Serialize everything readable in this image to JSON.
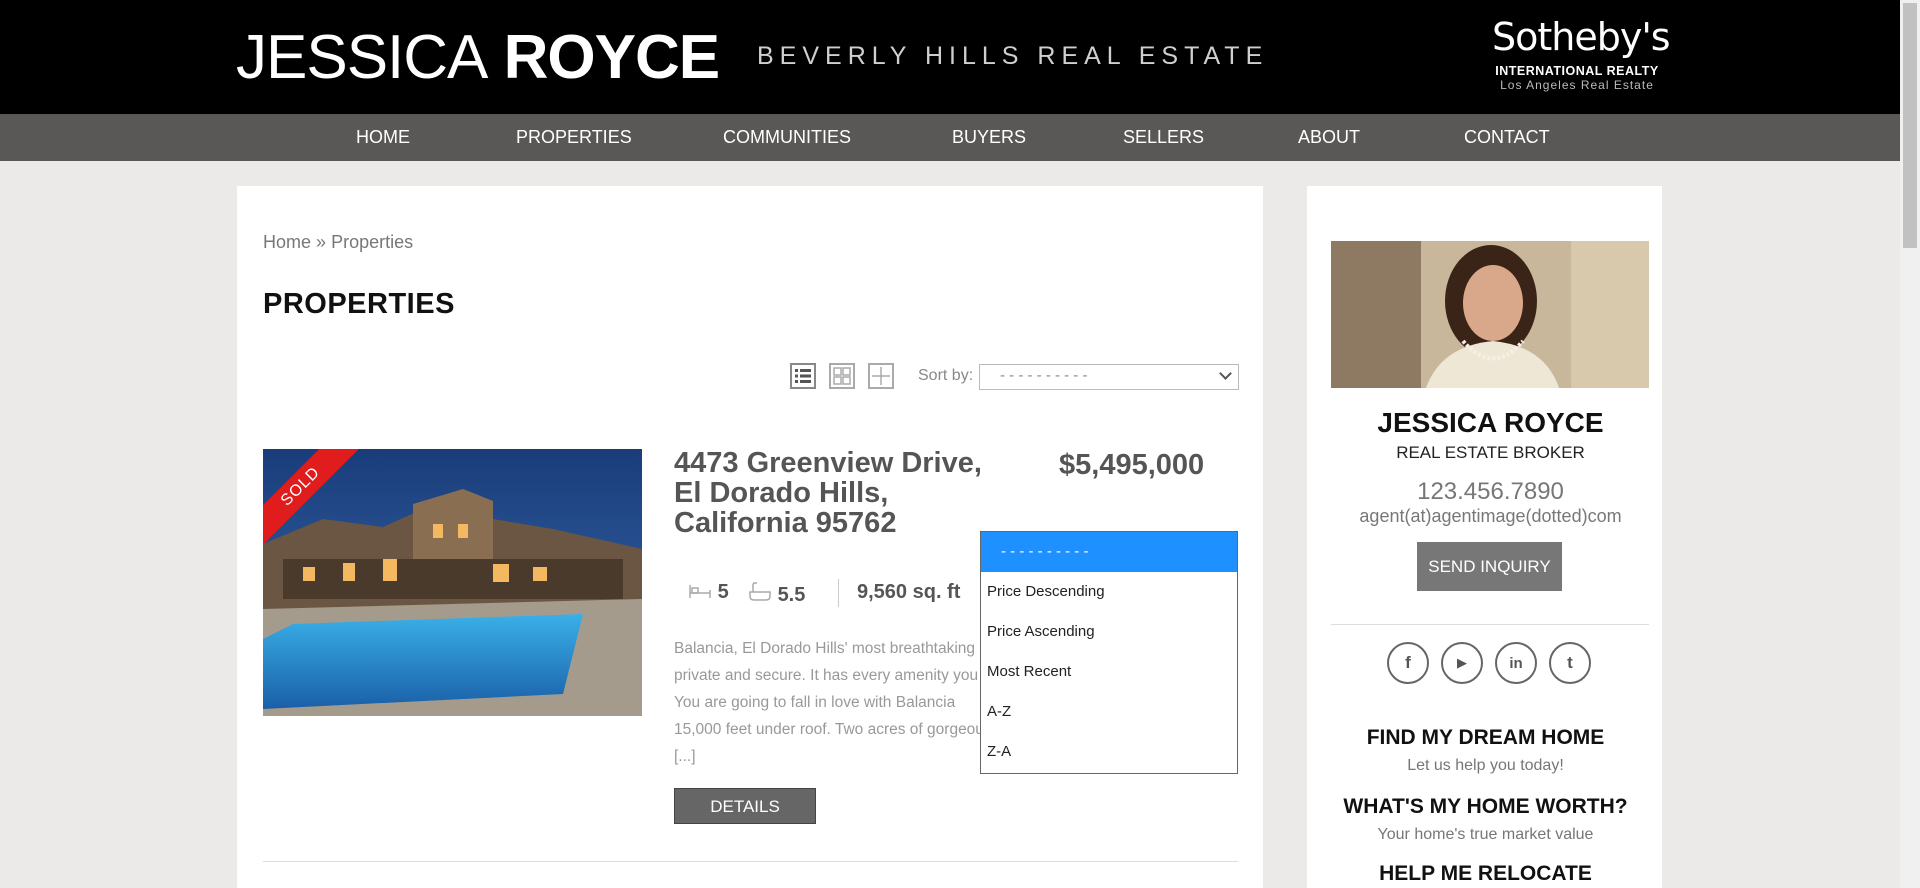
{
  "header": {
    "name_first": "JESSICA",
    "name_last": "ROYCE",
    "tagline": "BEVERLY HILLS REAL ESTATE",
    "brand_name": "Sotheby's",
    "brand_sub": "INTERNATIONAL REALTY",
    "brand_region": "Los Angeles Real Estate"
  },
  "nav": [
    "HOME",
    "PROPERTIES",
    "COMMUNITIES",
    "BUYERS",
    "SELLERS",
    "ABOUT",
    "CONTACT"
  ],
  "breadcrumb": {
    "home": "Home",
    "sep": "»",
    "current": "Properties"
  },
  "page_title": "PROPERTIES",
  "sort": {
    "label": "Sort by:",
    "selected": "- - - - - - - - - -",
    "options": [
      "- - - - - - - - - -",
      "Price Descending",
      "Price Ascending",
      "Most Recent",
      "A-Z",
      "Z-A"
    ]
  },
  "listing": {
    "badge": "SOLD",
    "address": "4473 Greenview Drive, El Dorado Hills, California 95762",
    "price": "$5,495,000",
    "beds": "5",
    "baths": "5.5",
    "sqft": "9,560 sq. ft",
    "description": "Balancia, El Dorado Hills' most breathtaking private and secure. It has every amenity you You are going to fall in love with Balancia 15,000 feet under roof. Two acres of gorgeous [...]",
    "details_label": "DETAILS"
  },
  "agent": {
    "name": "JESSICA ROYCE",
    "title": "REAL ESTATE BROKER",
    "phone": "123.456.7890",
    "email": "agent(at)agentimage(dotted)com",
    "inquiry_label": "SEND INQUIRY"
  },
  "social": [
    "f",
    "▶",
    "in",
    "t"
  ],
  "cta": [
    {
      "title": "FIND MY DREAM HOME",
      "sub": "Let us help you today!"
    },
    {
      "title": "WHAT'S MY HOME WORTH?",
      "sub": "Your home's true market value"
    },
    {
      "title": "HELP ME RELOCATE",
      "sub": ""
    }
  ]
}
